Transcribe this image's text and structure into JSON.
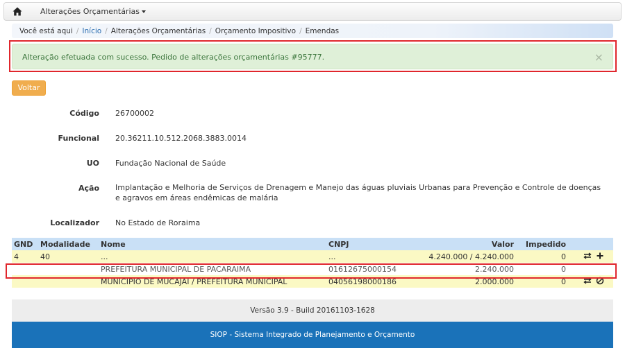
{
  "navbar": {
    "menu_label": "Alterações Orçamentárias",
    "home_icon": "home-icon"
  },
  "breadcrumb": {
    "prefix": "Você está aqui",
    "items": [
      "Início",
      "Alterações Orçamentárias",
      "Orçamento Impositivo",
      "Emendas"
    ]
  },
  "alert": {
    "message": "Alteração efetuada com sucesso. Pedido de alterações orçamentárias #95777.",
    "close": "×"
  },
  "actions": {
    "back_label": "Voltar"
  },
  "details": {
    "codigo_label": "Código",
    "codigo_value": "26700002",
    "funcional_label": "Funcional",
    "funcional_value": "20.36211.10.512.2068.3883.0014",
    "uo_label": "UO",
    "uo_value": "Fundação Nacional de Saúde",
    "acao_label": "Ação",
    "acao_value": "Implantação e Melhoria de Serviços de Drenagem e Manejo das águas pluviais Urbanas para Prevenção e Controle de doenças e agravos em áreas endêmicas de malária",
    "localizador_label": "Localizador",
    "localizador_value": "No Estado de Roraima"
  },
  "table": {
    "headers": {
      "gnd": "GND",
      "modalidade": "Modalidade",
      "nome": "Nome",
      "cnpj": "CNPJ",
      "valor": "Valor",
      "impedido": "Impedido"
    },
    "rows": [
      {
        "gnd": "4",
        "modalidade": "40",
        "nome": "...",
        "cnpj": "...",
        "valor": "4.240.000 / 4.240.000",
        "impedido": "0",
        "icons": [
          "transfer-icon",
          "plus-icon"
        ]
      },
      {
        "gnd": "",
        "modalidade": "",
        "nome": "PREFEITURA MUNICIPAL DE PACARAIMA",
        "cnpj": "01612675000154",
        "valor": "2.240.000",
        "impedido": "0",
        "icons": []
      },
      {
        "gnd": "",
        "modalidade": "",
        "nome": "MUNICIPIO DE MUCAJAI / PREFEITURA MUNICIPAL",
        "cnpj": "04056198000186",
        "valor": "2.000.000",
        "impedido": "0",
        "icons": [
          "transfer-icon",
          "ban-icon"
        ]
      }
    ]
  },
  "footer": {
    "version": "Versão 3.9 - Build 20161103-1628",
    "system": "SIOP - Sistema Integrado de Planejamento e Orçamento"
  },
  "colors": {
    "alert_bg": "#dff0d8",
    "alert_text": "#3c763d",
    "warning_button": "#f0ad4e",
    "table_header": "#c9e0f6",
    "row_highlight": "#fbf9c4",
    "footer_blue": "#1a72b9",
    "annotation_red": "#e0262c"
  }
}
